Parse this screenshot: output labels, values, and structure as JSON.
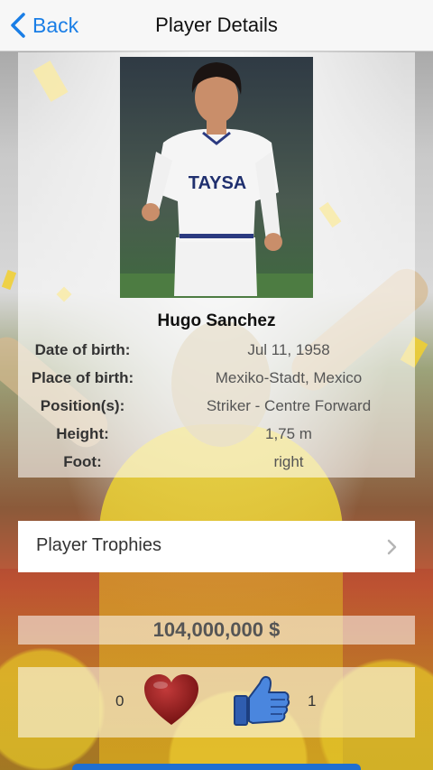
{
  "nav": {
    "back_label": "Back",
    "title": "Player Details"
  },
  "player": {
    "name": "Hugo Sanchez",
    "shirt_sponsor": "TAYSA",
    "details": [
      {
        "label": "Date of birth:",
        "value": "Jul 11, 1958"
      },
      {
        "label": "Place of birth:",
        "value": "Mexiko-Stadt, Mexico"
      },
      {
        "label": "Position(s):",
        "value": "Striker - Centre Forward"
      },
      {
        "label": "Height:",
        "value": "1,75 m"
      },
      {
        "label": "Foot:",
        "value": "right"
      }
    ]
  },
  "trophies": {
    "label": "Player Trophies",
    "icon": "chevron-right-icon"
  },
  "market_value": "104,000,000 $",
  "votes": {
    "dislike_count": "0",
    "like_count": "1",
    "heart_icon": "heart-icon",
    "like_icon": "thumbs-up-icon"
  },
  "colors": {
    "accent": "#1a7ee6",
    "heart": "#8e1616",
    "thumb": "#3b6fc6"
  }
}
